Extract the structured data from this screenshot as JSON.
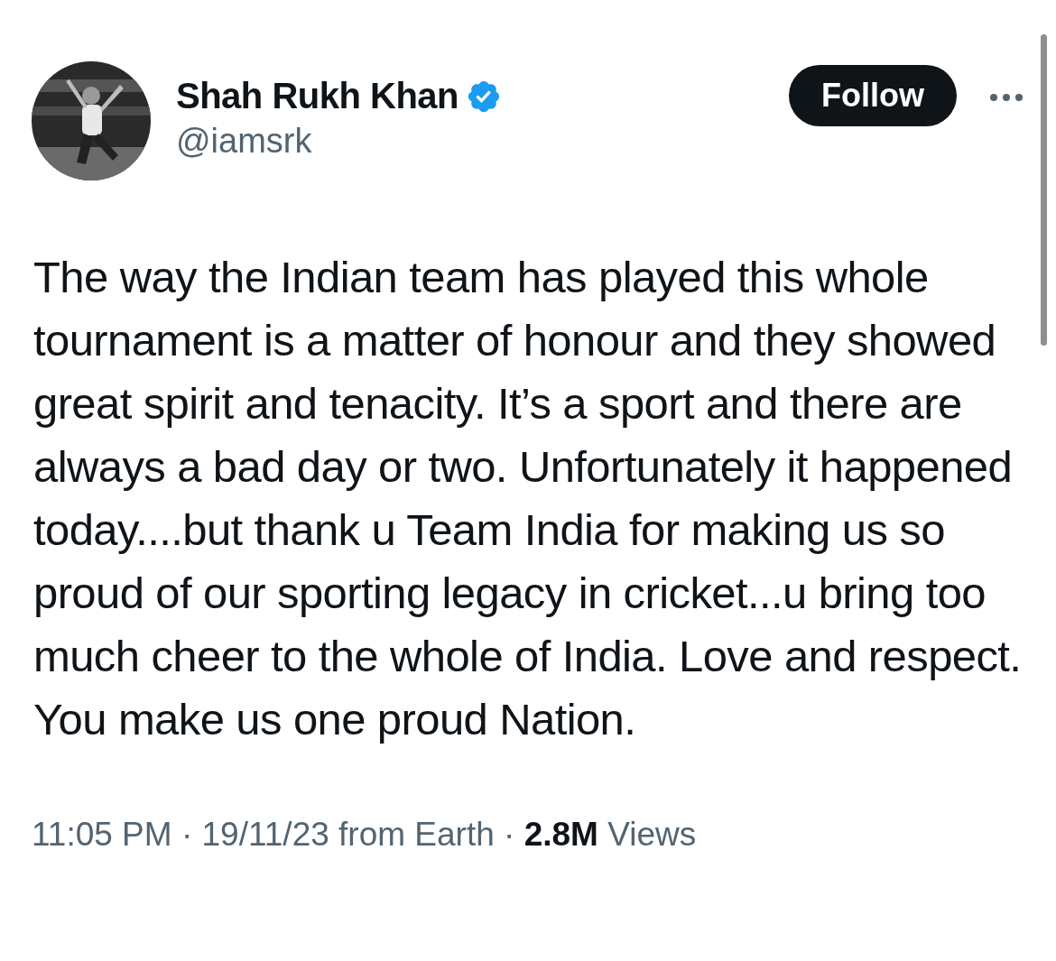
{
  "author": {
    "name": "Shah Rukh Khan",
    "verified": true,
    "handle": "@iamsrk"
  },
  "follow_button": {
    "label": "Follow"
  },
  "tweet": {
    "text": "The way the Indian team has played this whole tournament is a matter of honour and they showed great spirit and tenacity. It’s a sport and there are always a bad day or two. Unfortunately it happened today....but thank u Team India for making us so proud of our sporting legacy in cricket...u bring too much cheer to the whole of India. Love and respect. You make us one proud Nation."
  },
  "meta": {
    "text": "11:05 PM · 19/11/23 from Earth · **2.8M** Views"
  }
}
